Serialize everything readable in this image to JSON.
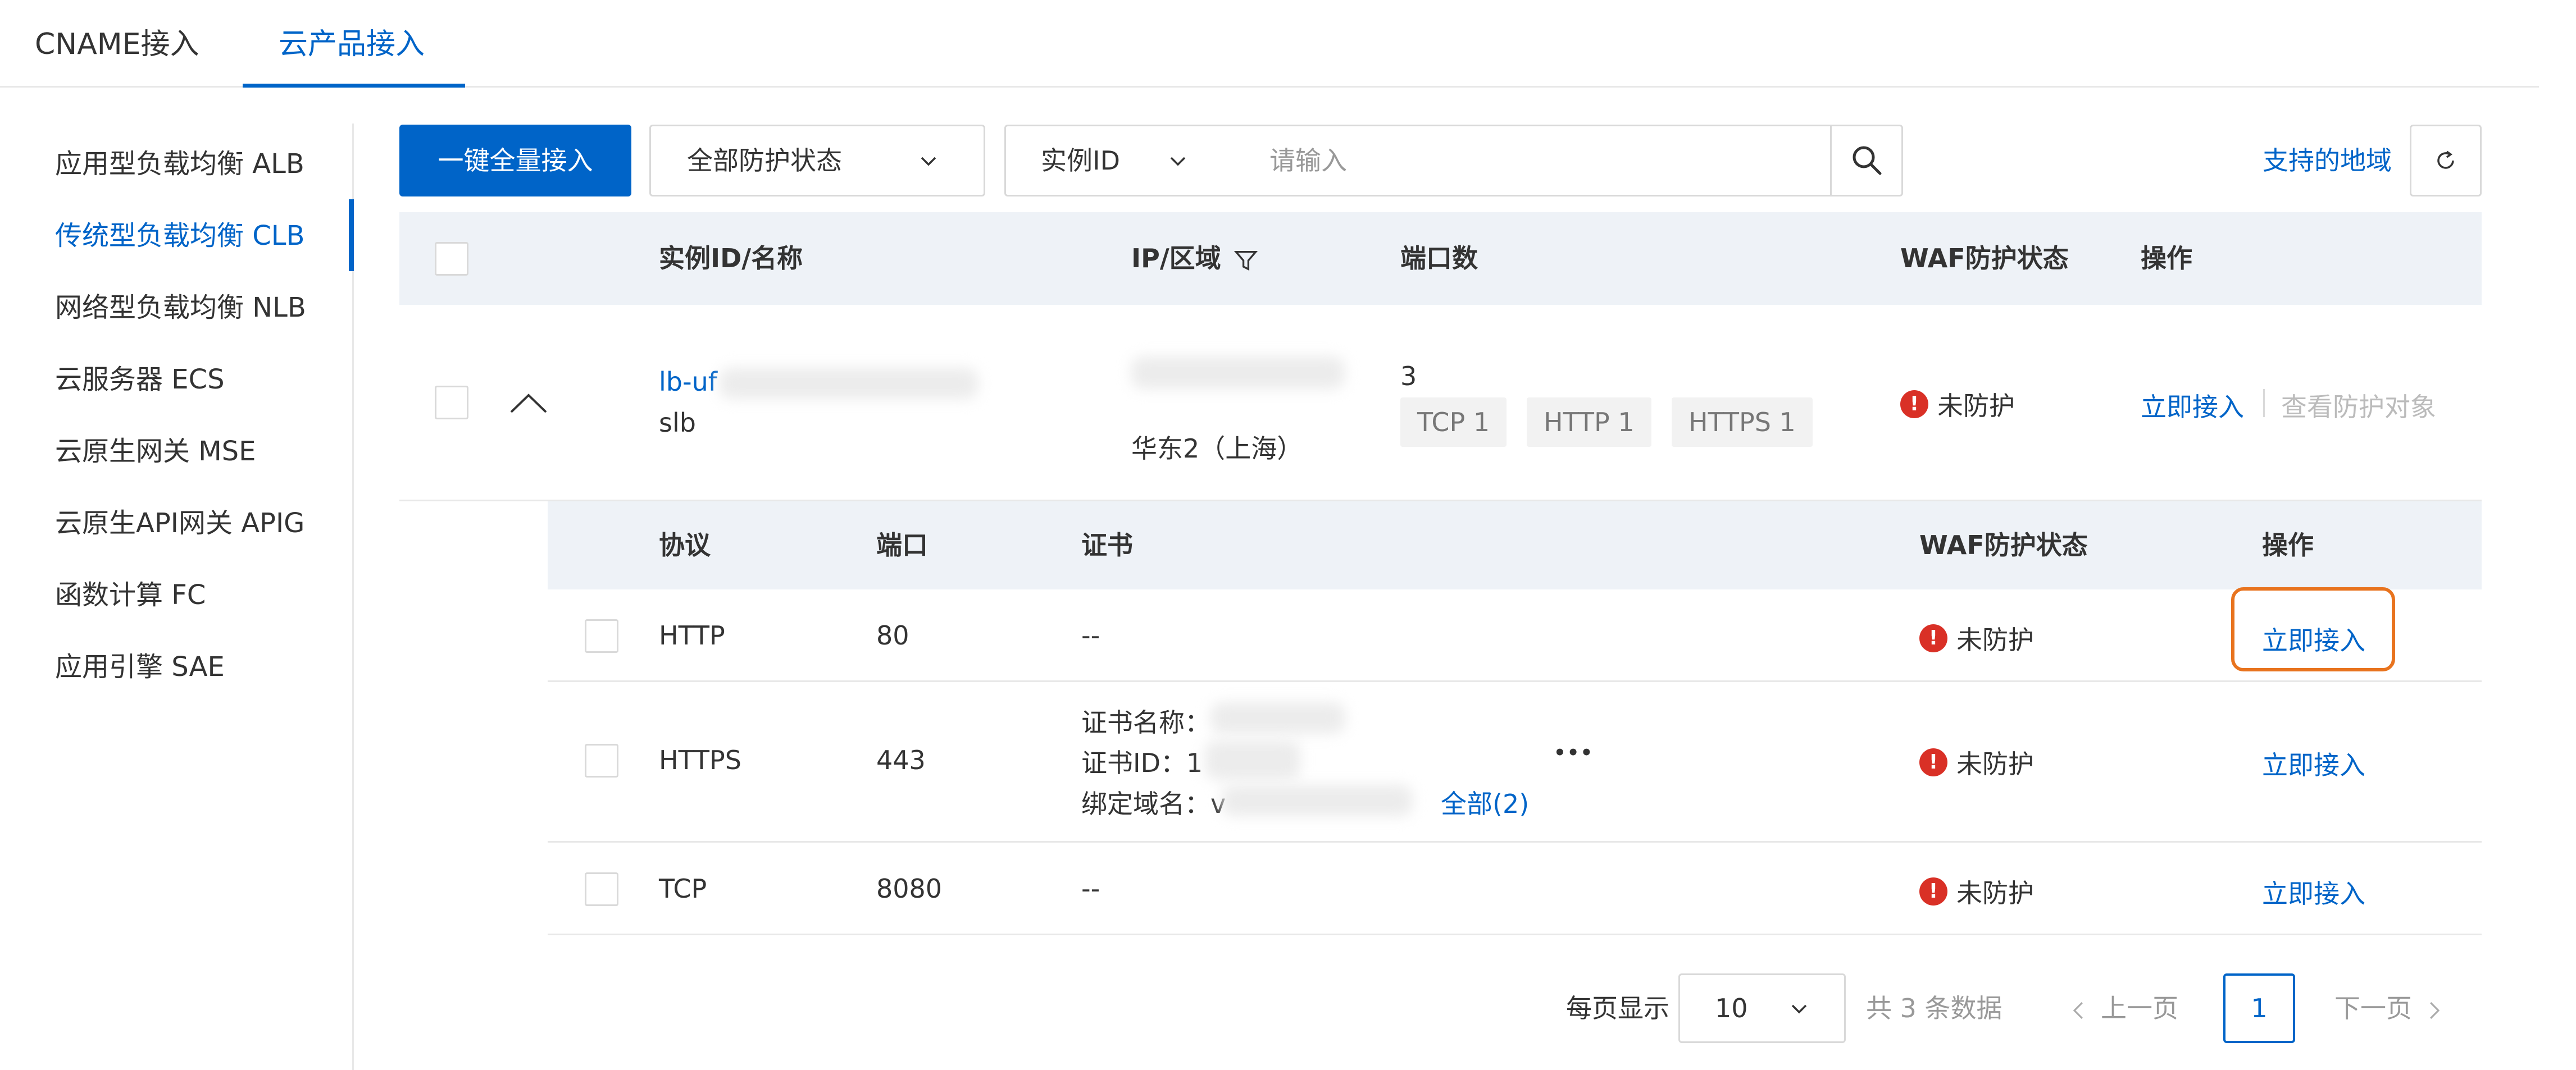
{
  "tabs": [
    {
      "label": "CNAME接入"
    },
    {
      "label": "云产品接入"
    }
  ],
  "sidebar": {
    "items": [
      {
        "label": "应用型负载均衡 ALB"
      },
      {
        "label": "传统型负载均衡 CLB"
      },
      {
        "label": "网络型负载均衡 NLB"
      },
      {
        "label": "云服务器 ECS"
      },
      {
        "label": "云原生网关 MSE"
      },
      {
        "label": "云原生API网关 APIG"
      },
      {
        "label": "函数计算 FC"
      },
      {
        "label": "应用引擎 SAE"
      }
    ],
    "active_index": 1
  },
  "toolbar": {
    "onekey_label": "一键全量接入",
    "status_select": "全部防护状态",
    "field_select": "实例ID",
    "search_placeholder": "请输入",
    "region_link": "支持的地域"
  },
  "table": {
    "headers": {
      "instance": "实例ID/名称",
      "ip_region": "IP/区域",
      "ports": "端口数",
      "waf_status": "WAF防护状态",
      "actions": "操作"
    },
    "row": {
      "instance_id_prefix": "lb-uf",
      "instance_name": "slb",
      "region": "华东2（上海）",
      "port_count": "3",
      "tags": [
        "TCP 1",
        "HTTP 1",
        "HTTPS 1"
      ],
      "waf_status": "未防护",
      "action_primary": "立即接入",
      "action_secondary": "查看防护对象"
    }
  },
  "subtable": {
    "headers": {
      "protocol": "协议",
      "port": "端口",
      "cert": "证书",
      "waf_status": "WAF防护状态",
      "actions": "操作"
    },
    "rows": [
      {
        "protocol": "HTTP",
        "port": "80",
        "cert": "--",
        "waf_status": "未防护",
        "action": "立即接入"
      },
      {
        "protocol": "HTTPS",
        "port": "443",
        "cert_name_label": "证书名称：",
        "cert_id_label": "证书ID：",
        "cert_id_prefix": "1",
        "bound_domain_label": "绑定域名：",
        "bound_domain_prefix": "v",
        "all_link": "全部(2)",
        "more": "•••",
        "waf_status": "未防护",
        "action": "立即接入"
      },
      {
        "protocol": "TCP",
        "port": "8080",
        "cert": "--",
        "waf_status": "未防护",
        "action": "立即接入"
      }
    ]
  },
  "pagination": {
    "per_page_label": "每页显示",
    "page_size": "10",
    "total_text": "共 3 条数据",
    "prev_label": "上一页",
    "current_page": "1",
    "next_label": "下一页"
  },
  "colors": {
    "primary": "#0064c8",
    "danger": "#d93026",
    "highlight": "#e8731e"
  }
}
